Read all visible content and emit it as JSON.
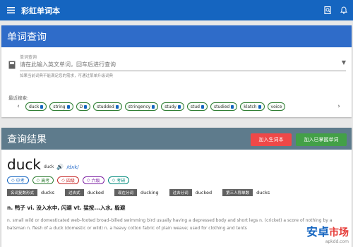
{
  "appbar": {
    "title": "彩虹单词本"
  },
  "query_card": {
    "title": "单词查询",
    "label": "单词查询",
    "placeholder": "请在此输入英文单词，回车后进行查询",
    "hint": "如果当前词典不能满足您的需求，可通过菜单升级词典",
    "recent_label": "最近搜索:",
    "recent": [
      "duck",
      "string",
      "D",
      "studded",
      "stringency",
      "study",
      "stud",
      "studied",
      "klatch",
      "voice"
    ]
  },
  "result_card": {
    "title": "查询结果",
    "add_new_label": "加入生词本",
    "add_mastered_label": "加入已掌握单词",
    "word": "duck",
    "word_small": "duck",
    "phonetic": "/dʌk/",
    "tags": [
      "中考",
      "高考",
      "四级",
      "六级",
      "考研"
    ],
    "forms": [
      {
        "label": "名词复数形式",
        "value": "ducks"
      },
      {
        "label": "过去式",
        "value": "ducked"
      },
      {
        "label": "现在分词",
        "value": "ducking"
      },
      {
        "label": "过去分词",
        "value": "ducked"
      },
      {
        "label": "第三人称单数",
        "value": "ducks"
      }
    ],
    "meaning": "n. 鸭子 vi. 没入水中, 闪避 vt. 猛按...入水, 躲避",
    "definition": "n. small wild or domesticated web–footed broad–billed swimming bird usually having a depressed body and short legs n. (cricket) a score of nothing by a batsman n. flesh of a duck (domestic or wild) n. a heavy cotton fabric of plain weave; used for clothing and tents"
  },
  "watermark": {
    "cn1": "安卓",
    "cn2": "市场",
    "domain": "apkdd.com"
  },
  "colors": {
    "primary": "#1565c0",
    "query_head": "#2f6cc9",
    "result_head": "#5e7b8c",
    "red": "#ef4848",
    "green": "#43a047"
  }
}
